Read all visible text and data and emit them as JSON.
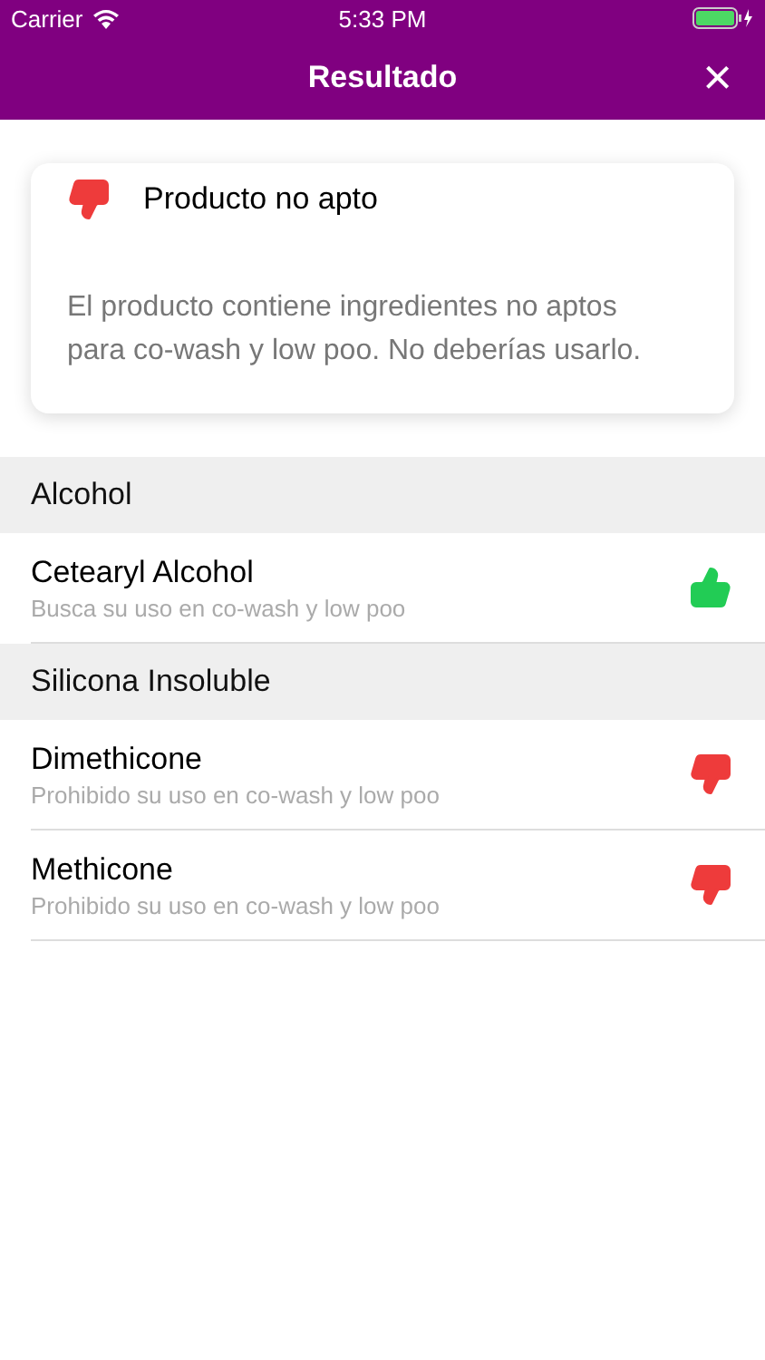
{
  "status_bar": {
    "carrier": "Carrier",
    "time": "5:33 PM"
  },
  "nav": {
    "title": "Resultado",
    "close": "×"
  },
  "summary": {
    "kind": "bad",
    "title": "Producto no apto",
    "message": "El producto contiene ingredientes no aptos para co-wash y low poo. No deberías usarlo."
  },
  "sections": [
    {
      "title": "Alcohol",
      "items": [
        {
          "name": "Cetearyl Alcohol",
          "note": "Busca su uso en co-wash y low poo",
          "kind": "good"
        }
      ]
    },
    {
      "title": "Silicona Insoluble",
      "items": [
        {
          "name": "Dimethicone",
          "note": "Prohibido su uso en co-wash y low poo",
          "kind": "bad"
        },
        {
          "name": "Methicone",
          "note": "Prohibido su uso en co-wash y low poo",
          "kind": "bad"
        }
      ]
    }
  ]
}
